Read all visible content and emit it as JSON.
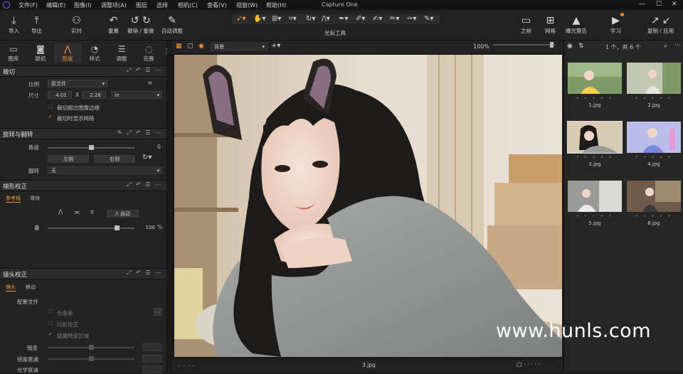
{
  "menubar": {
    "items": [
      "文件(F)",
      "编辑(E)",
      "图像(I)",
      "调整项(A)",
      "图层",
      "选择",
      "相机(C)",
      "查看(V)",
      "视窗(W)",
      "帮助(H)"
    ],
    "title": "Capture One",
    "window_controls": [
      "—",
      "☐",
      "✕"
    ]
  },
  "toolbar": {
    "import": "导入",
    "export": "导出",
    "live": "实时",
    "reset": "重置",
    "undo_redo": "撤销 / 重做",
    "auto_adjust": "自动调整",
    "cursor_tools": "光标工具",
    "before": "之前",
    "grid": "网格",
    "exposure_warning": "曝光警告",
    "learn": "学习",
    "copy_apply": "复制 / 应用"
  },
  "left_tabs": [
    {
      "label": "图库",
      "icon": "folder-icon"
    },
    {
      "label": "联机",
      "icon": "camera-icon"
    },
    {
      "label": "形状",
      "icon": "shape-icon"
    },
    {
      "label": "样式",
      "icon": "style-icon"
    },
    {
      "label": "调整",
      "icon": "sliders-icon"
    },
    {
      "label": "完善",
      "icon": "refine-icon"
    }
  ],
  "crop": {
    "title": "裁切",
    "ratio_label": "比例",
    "ratio_value": "原文件",
    "size_label": "尺寸",
    "width": "4.01",
    "x": "X",
    "height": "2.26",
    "unit": "in",
    "option1": "裁切超出图像边缘",
    "option2": "裁切时显示网格"
  },
  "rotation": {
    "title": "旋转与翻转",
    "angle_label": "角度",
    "angle_value": "0",
    "angle_fraction": 0.5,
    "left_btn": "左侧",
    "right_btn": "右侧",
    "flip_label": "翻转",
    "flip_value": "无"
  },
  "keystone": {
    "title": "梯形校正",
    "tab1": "参考线",
    "tab2": "滑块",
    "auto_btn": "自动",
    "amount_label": "量",
    "amount_value": "100",
    "percent": "%",
    "amount_fraction": 0.8
  },
  "lens": {
    "title": "镜头校正",
    "tab1": "镜头",
    "tab2": "移动",
    "profile_label": "配置文件",
    "opt1": "色像差",
    "opt2": "衍射校正",
    "opt3": "隐藏畸变区域",
    "dark_label": "暗变",
    "sharp_label": "锐度衰减",
    "light_label": "光学衰减"
  },
  "viewerbar": {
    "style_value": "背景",
    "zoom": "100%"
  },
  "viewer": {
    "filename": "3.jpg"
  },
  "browser": {
    "count": "1 个，共 6 个",
    "thumbs": [
      "1.jpg",
      "2.jpg",
      "3.jpg",
      "4.jpg",
      "5.jpg",
      "6.jpg"
    ],
    "selected": "3.jpg"
  },
  "watermark": "www.hunls.com",
  "colors": {
    "accent": "#ff9a3c",
    "background": "#1e1e1e",
    "panel": "#232323"
  }
}
